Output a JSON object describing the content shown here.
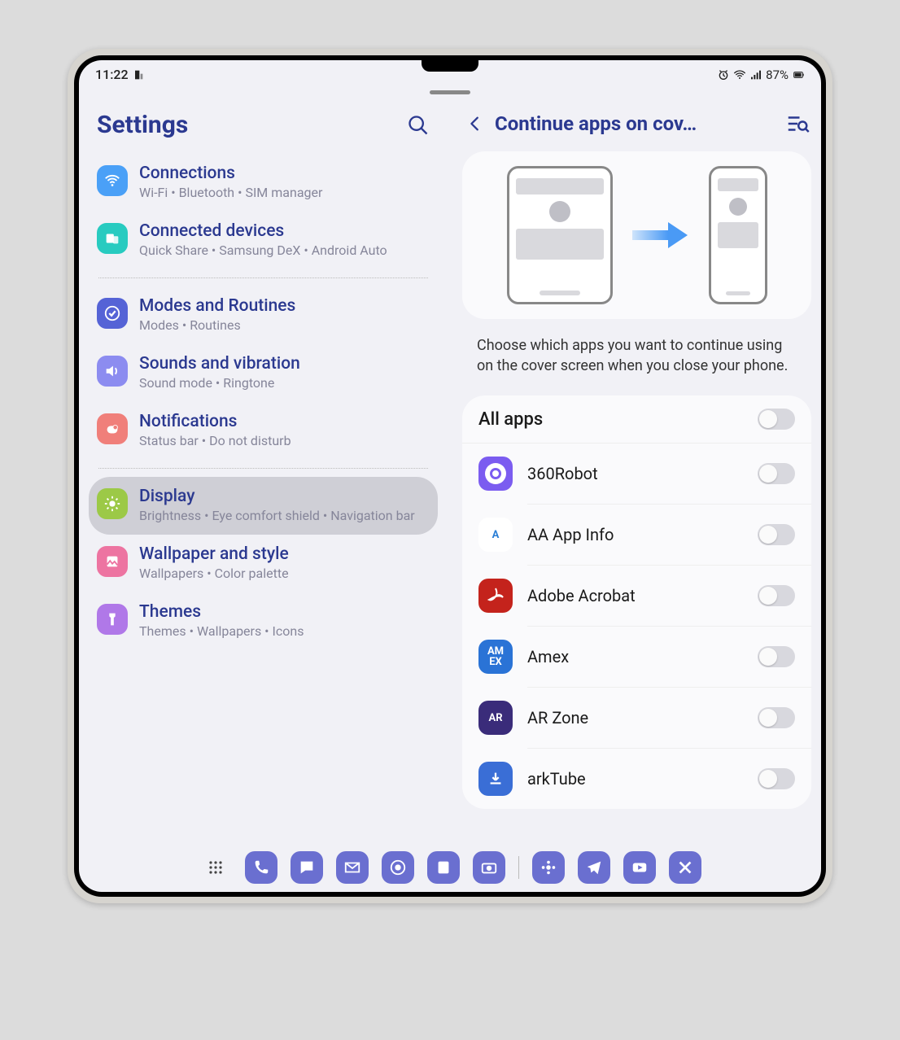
{
  "status": {
    "time": "11:22",
    "battery": "87%"
  },
  "left": {
    "title": "Settings"
  },
  "settings": [
    {
      "title": "Connections",
      "sub": "Wi-Fi  •  Bluetooth  •  SIM manager",
      "color": "#4aa0f7",
      "icon": "wifi"
    },
    {
      "title": "Connected devices",
      "sub": "Quick Share  •  Samsung DeX  •  Android Auto",
      "color": "#28cbc0",
      "icon": "devices"
    },
    {
      "divider": true
    },
    {
      "title": "Modes and Routines",
      "sub": "Modes  •  Routines",
      "color": "#5563d6",
      "icon": "check"
    },
    {
      "title": "Sounds and vibration",
      "sub": "Sound mode  •  Ringtone",
      "color": "#8c8cf0",
      "icon": "sound"
    },
    {
      "title": "Notifications",
      "sub": "Status bar  •  Do not disturb",
      "color": "#f07f7a",
      "icon": "notif"
    },
    {
      "divider": true
    },
    {
      "title": "Display",
      "sub": "Brightness  •  Eye comfort shield  •  Navigation bar",
      "color": "#9cc947",
      "icon": "brightness",
      "selected": true
    },
    {
      "title": "Wallpaper and style",
      "sub": "Wallpapers  •  Color palette",
      "color": "#ed74a1",
      "icon": "wallpaper"
    },
    {
      "title": "Themes",
      "sub": "Themes  •  Wallpapers  •  Icons",
      "color": "#b078e8",
      "icon": "themes"
    }
  ],
  "right": {
    "title": "Continue apps on cov…",
    "desc": "Choose which apps you want to continue using on the cover screen when you close your phone.",
    "all_apps": "All apps"
  },
  "apps": [
    {
      "name": "360Robot",
      "color": "#7b5cf0",
      "icon": "circle"
    },
    {
      "name": "AA App Info",
      "color": "#fff",
      "fg": "#2b7fd6",
      "icon": "A"
    },
    {
      "name": "Adobe Acrobat",
      "color": "#c4231c",
      "icon": "acrobat"
    },
    {
      "name": "Amex",
      "color": "#2a73d6",
      "icon": "AM EX"
    },
    {
      "name": "AR Zone",
      "color": "#3a2c7a",
      "icon": "AR"
    },
    {
      "name": "arkTube",
      "color": "#3a6ed6",
      "icon": "download"
    }
  ]
}
